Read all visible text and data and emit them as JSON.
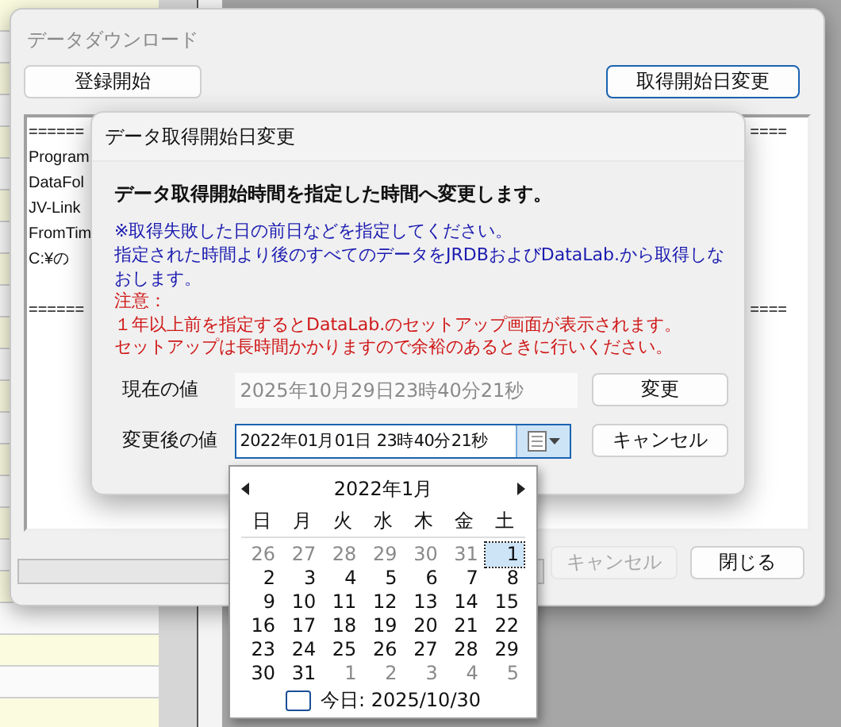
{
  "main_window": {
    "title": "データダウンロード",
    "register_button": "登録開始",
    "change_start_button": "取得開始日変更",
    "log_lines": [
      {
        "kind": "text",
        "text": "======",
        "tail": "===="
      },
      {
        "kind": "text",
        "text": "Program"
      },
      {
        "kind": "text",
        "text": "DataFol"
      },
      {
        "kind": "text",
        "text": "JV-Link"
      },
      {
        "kind": "text",
        "text": "FromTim"
      },
      {
        "kind": "text",
        "text": "C:¥の"
      },
      {
        "kind": "blank"
      },
      {
        "kind": "text",
        "text": "======",
        "tail": "===="
      }
    ],
    "progress": {
      "level": 0
    },
    "cancel_button": {
      "label": "キャンセル",
      "disabled": true
    },
    "close_button": {
      "label": "閉じる",
      "disabled": false
    }
  },
  "dialog": {
    "title": "データ取得開始日変更",
    "heading": "データ取得開始時間を指定した時間へ変更します。",
    "info_lines": [
      "※取得失敗した日の前日などを指定してください。",
      "指定された時間より後のすべてのデータをJRDBおよびDataLab.から取得しなおします。"
    ],
    "warning_lines": [
      "注意：",
      "１年以上前を指定するとDataLab.のセットアップ画面が表示されます。",
      "セットアップは長時間かかりますので余裕のあるときに行いください。"
    ],
    "current_label": "現在の値",
    "current_value": "2025年10月29日23時40分21秒",
    "change_button": "変更",
    "new_label": "変更後の値",
    "new_value": "2022年01月01日 23時40分21秒",
    "cancel_button": "キャンセル"
  },
  "calendar": {
    "month_title": "2022年1月",
    "weekdays": [
      "日",
      "月",
      "火",
      "水",
      "木",
      "金",
      "土"
    ],
    "weeks": [
      [
        {
          "day": "26",
          "kind": "other",
          "selected": false
        },
        {
          "day": "27",
          "kind": "other",
          "selected": false
        },
        {
          "day": "28",
          "kind": "other",
          "selected": false
        },
        {
          "day": "29",
          "kind": "other",
          "selected": false
        },
        {
          "day": "30",
          "kind": "other",
          "selected": false
        },
        {
          "day": "31",
          "kind": "other",
          "selected": false
        },
        {
          "day": "1",
          "kind": "current",
          "selected": true
        }
      ],
      [
        {
          "day": "2",
          "kind": "current",
          "selected": false
        },
        {
          "day": "3",
          "kind": "current",
          "selected": false
        },
        {
          "day": "4",
          "kind": "current",
          "selected": false
        },
        {
          "day": "5",
          "kind": "current",
          "selected": false
        },
        {
          "day": "6",
          "kind": "current",
          "selected": false
        },
        {
          "day": "7",
          "kind": "current",
          "selected": false
        },
        {
          "day": "8",
          "kind": "current",
          "selected": false
        }
      ],
      [
        {
          "day": "9",
          "kind": "current",
          "selected": false
        },
        {
          "day": "10",
          "kind": "current",
          "selected": false
        },
        {
          "day": "11",
          "kind": "current",
          "selected": false
        },
        {
          "day": "12",
          "kind": "current",
          "selected": false
        },
        {
          "day": "13",
          "kind": "current",
          "selected": false
        },
        {
          "day": "14",
          "kind": "current",
          "selected": false
        },
        {
          "day": "15",
          "kind": "current",
          "selected": false
        }
      ],
      [
        {
          "day": "16",
          "kind": "current",
          "selected": false
        },
        {
          "day": "17",
          "kind": "current",
          "selected": false
        },
        {
          "day": "18",
          "kind": "current",
          "selected": false
        },
        {
          "day": "19",
          "kind": "current",
          "selected": false
        },
        {
          "day": "20",
          "kind": "current",
          "selected": false
        },
        {
          "day": "21",
          "kind": "current",
          "selected": false
        },
        {
          "day": "22",
          "kind": "current",
          "selected": false
        }
      ],
      [
        {
          "day": "23",
          "kind": "current",
          "selected": false
        },
        {
          "day": "24",
          "kind": "current",
          "selected": false
        },
        {
          "day": "25",
          "kind": "current",
          "selected": false
        },
        {
          "day": "26",
          "kind": "current",
          "selected": false
        },
        {
          "day": "27",
          "kind": "current",
          "selected": false
        },
        {
          "day": "28",
          "kind": "current",
          "selected": false
        },
        {
          "day": "29",
          "kind": "current",
          "selected": false
        }
      ],
      [
        {
          "day": "30",
          "kind": "current",
          "selected": false
        },
        {
          "day": "31",
          "kind": "current",
          "selected": false
        },
        {
          "day": "1",
          "kind": "other",
          "selected": false
        },
        {
          "day": "2",
          "kind": "other",
          "selected": false
        },
        {
          "day": "3",
          "kind": "other",
          "selected": false
        },
        {
          "day": "4",
          "kind": "other",
          "selected": false
        },
        {
          "day": "5",
          "kind": "other",
          "selected": false
        }
      ]
    ],
    "today": "今日: 2025/10/30"
  }
}
